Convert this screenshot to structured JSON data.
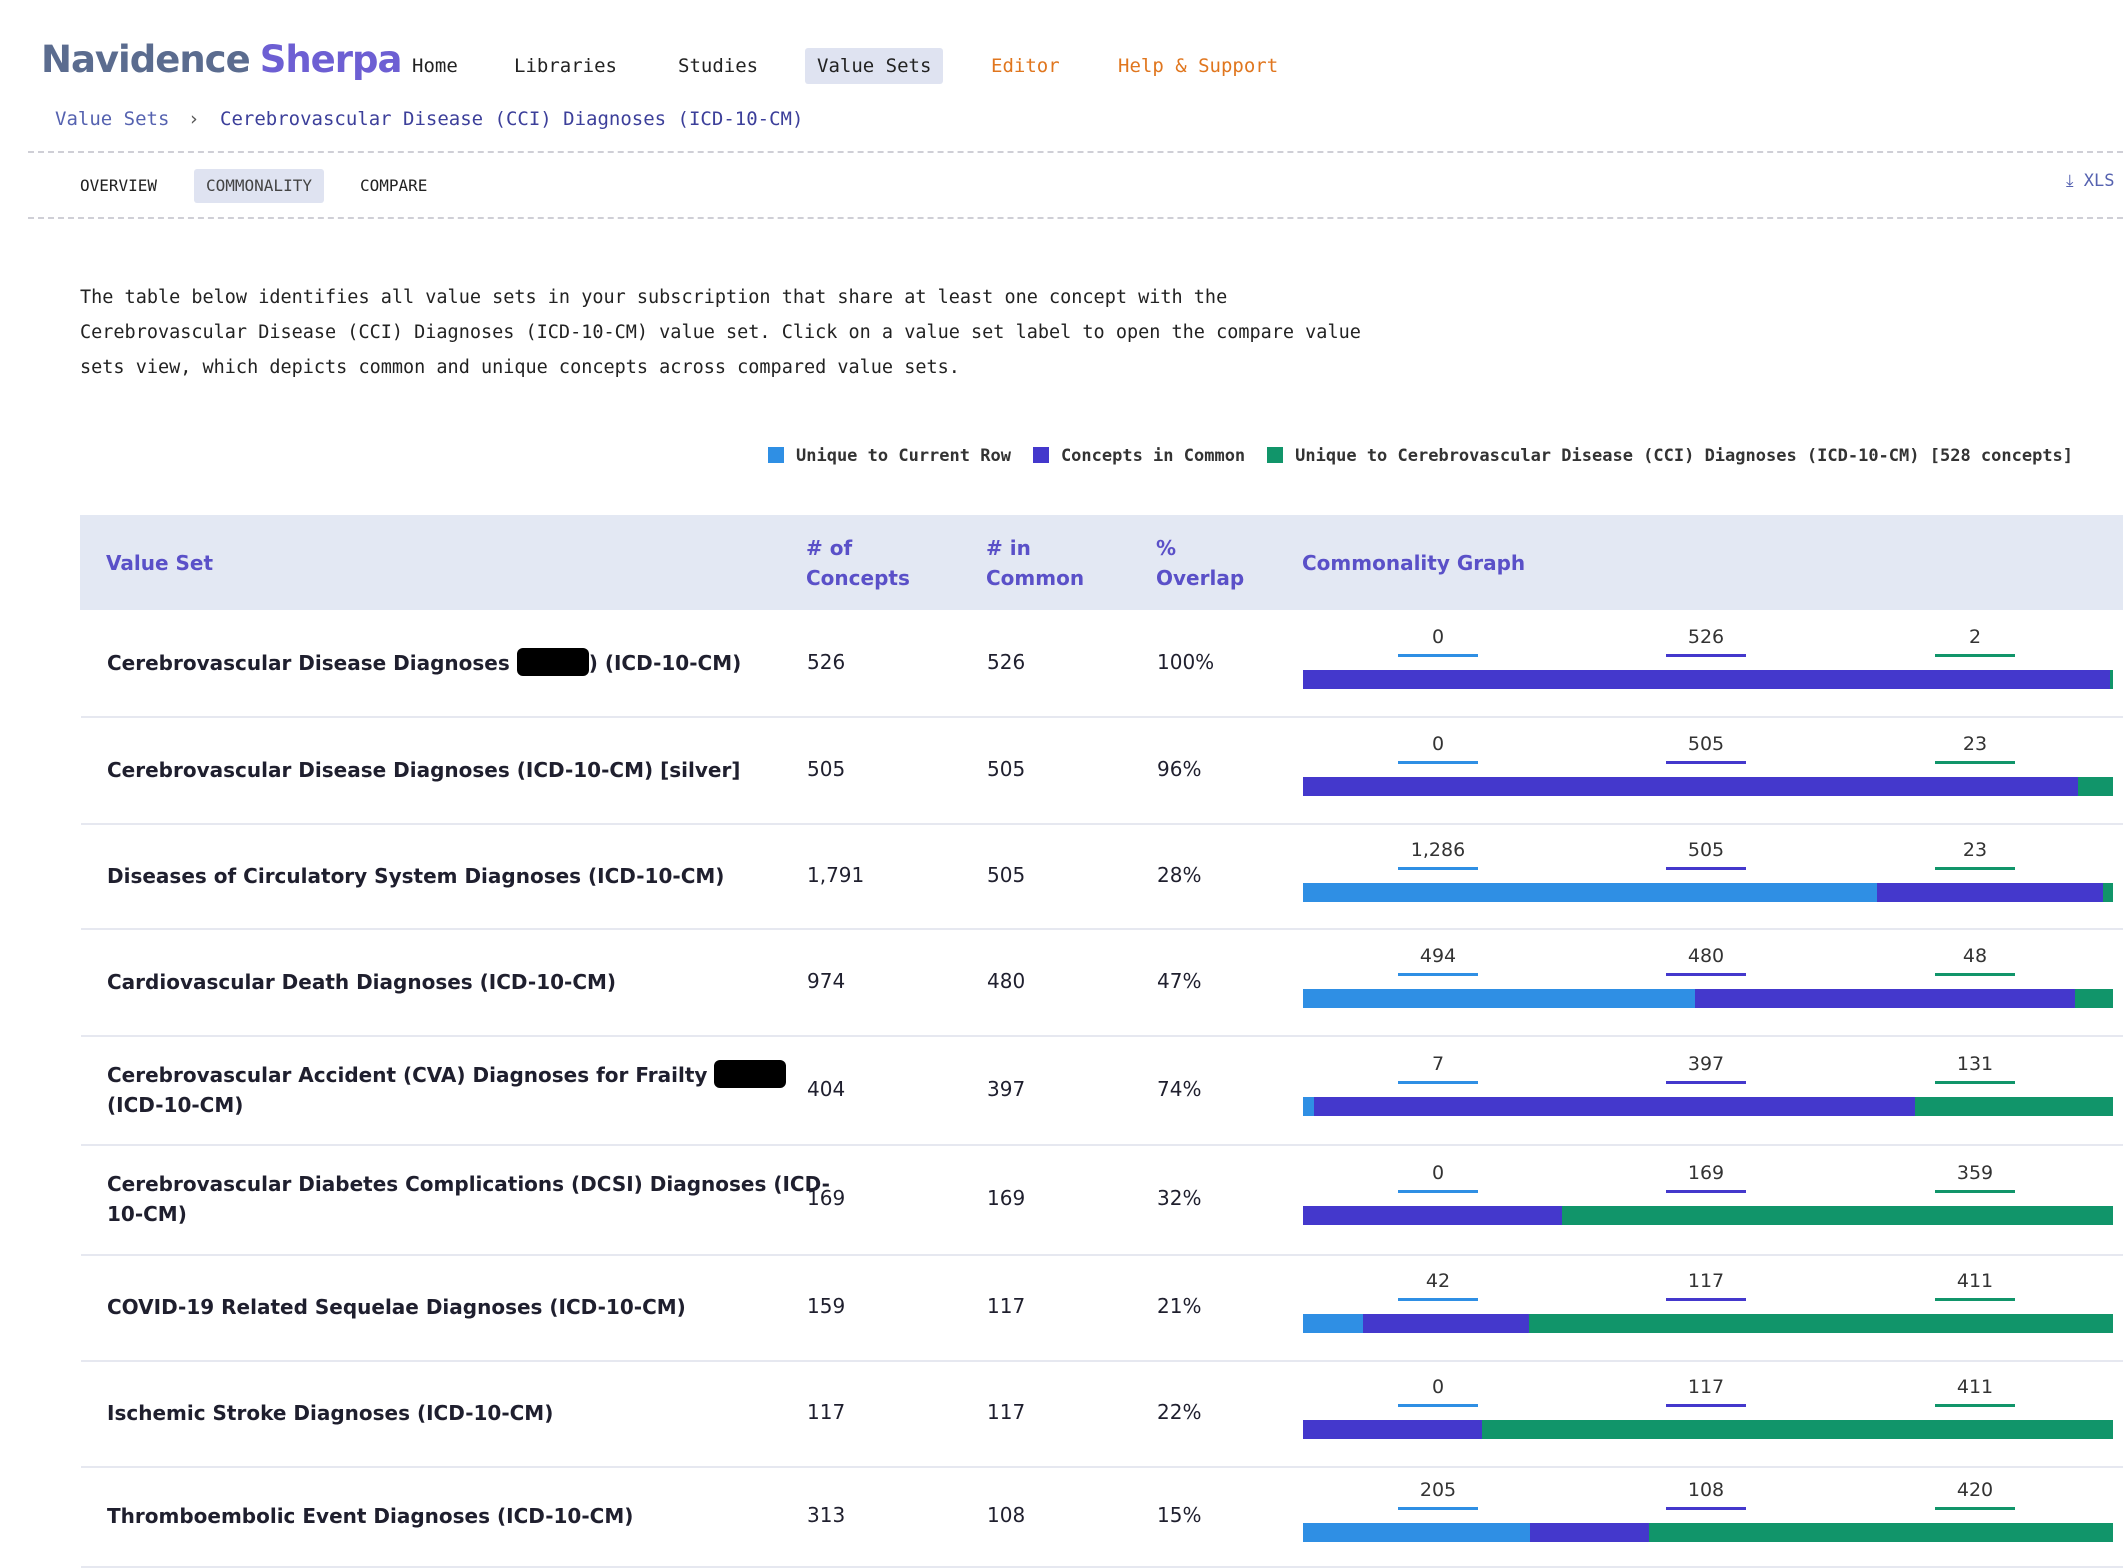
{
  "app": {
    "logo_part1": "Navidence",
    "logo_part2": "Sherpa"
  },
  "nav": [
    {
      "label": "Home"
    },
    {
      "label": "Libraries"
    },
    {
      "label": "Studies"
    },
    {
      "label": "Value Sets"
    },
    {
      "label": "Editor"
    },
    {
      "label": "Help & Support"
    }
  ],
  "breadcrumb": {
    "root": "Value Sets",
    "sep": "›",
    "current": "Cerebrovascular Disease (CCI) Diagnoses (ICD-10-CM)"
  },
  "tabs": [
    {
      "label": "OVERVIEW"
    },
    {
      "label": "COMMONALITY"
    },
    {
      "label": "COMPARE"
    }
  ],
  "export_label": "XLS",
  "description": [
    "The table below identifies all value sets in your subscription that share at least one concept with the",
    "Cerebrovascular Disease (CCI) Diagnoses (ICD-10-CM) value set. Click on a value set label to open the compare value",
    "sets view, which depicts common and unique concepts across compared value sets."
  ],
  "legend": [
    {
      "label": "Unique to Current Row",
      "color": "#2f8fe4"
    },
    {
      "label": "Concepts in Common",
      "color": "#4438cc"
    },
    {
      "label": "Unique to Cerebrovascular Disease (CCI) Diagnoses (ICD-10-CM) [528 concepts]",
      "color": "#11956a"
    }
  ],
  "table": {
    "headers": {
      "value_set": "Value Set",
      "concepts": "# of Concepts",
      "common": "# in Common",
      "overlap": "% Overlap",
      "graph": "Commonality Graph"
    },
    "rows": [
      {
        "name_a": "Cerebrovascular Disease Diagnoses",
        "redacted": true,
        "name_b": ") (ICD-10-CM)",
        "concepts": "526",
        "common": "526",
        "overlap": "100%",
        "unique_row": 0,
        "in_common": 526,
        "unique_ref": 2,
        "unique_row_label": "0",
        "in_common_label": "526",
        "unique_ref_label": "2"
      },
      {
        "name_a": "Cerebrovascular Disease Diagnoses (ICD-10-CM) [silver]",
        "redacted": false,
        "name_b": "",
        "concepts": "505",
        "common": "505",
        "overlap": "96%",
        "unique_row": 0,
        "in_common": 505,
        "unique_ref": 23,
        "unique_row_label": "0",
        "in_common_label": "505",
        "unique_ref_label": "23"
      },
      {
        "name_a": "Diseases of Circulatory System Diagnoses (ICD-10-CM)",
        "redacted": false,
        "name_b": "",
        "concepts": "1,791",
        "common": "505",
        "overlap": "28%",
        "unique_row": 1286,
        "in_common": 505,
        "unique_ref": 23,
        "unique_row_label": "1,286",
        "in_common_label": "505",
        "unique_ref_label": "23"
      },
      {
        "name_a": "Cardiovascular Death Diagnoses (ICD-10-CM)",
        "redacted": false,
        "name_b": "",
        "concepts": "974",
        "common": "480",
        "overlap": "47%",
        "unique_row": 494,
        "in_common": 480,
        "unique_ref": 48,
        "unique_row_label": "494",
        "in_common_label": "480",
        "unique_ref_label": "48"
      },
      {
        "name_a": "Cerebrovascular Accident (CVA) Diagnoses for Frailty",
        "redacted": true,
        "name_b": "(ICD-10-CM)",
        "concepts": "404",
        "common": "397",
        "overlap": "74%",
        "unique_row": 7,
        "in_common": 397,
        "unique_ref": 131,
        "unique_row_label": "7",
        "in_common_label": "397",
        "unique_ref_label": "131"
      },
      {
        "name_a": "Cerebrovascular Diabetes Complications (DCSI) Diagnoses (ICD-10-CM)",
        "redacted": false,
        "name_b": "",
        "concepts": "169",
        "common": "169",
        "overlap": "32%",
        "unique_row": 0,
        "in_common": 169,
        "unique_ref": 359,
        "unique_row_label": "0",
        "in_common_label": "169",
        "unique_ref_label": "359"
      },
      {
        "name_a": "COVID-19 Related Sequelae Diagnoses (ICD-10-CM)",
        "redacted": false,
        "name_b": "",
        "concepts": "159",
        "common": "117",
        "overlap": "21%",
        "unique_row": 42,
        "in_common": 117,
        "unique_ref": 411,
        "unique_row_label": "42",
        "in_common_label": "117",
        "unique_ref_label": "411"
      },
      {
        "name_a": "Ischemic Stroke Diagnoses (ICD-10-CM)",
        "redacted": false,
        "name_b": "",
        "concepts": "117",
        "common": "117",
        "overlap": "22%",
        "unique_row": 0,
        "in_common": 117,
        "unique_ref": 411,
        "unique_row_label": "0",
        "in_common_label": "117",
        "unique_ref_label": "411"
      },
      {
        "name_a": "Thromboembolic Event Diagnoses (ICD-10-CM)",
        "redacted": false,
        "name_b": "",
        "concepts": "313",
        "common": "108",
        "overlap": "15%",
        "unique_row": 205,
        "in_common": 108,
        "unique_ref": 420,
        "unique_row_label": "205",
        "in_common_label": "108",
        "unique_ref_label": "420"
      }
    ]
  },
  "colors": {
    "unique_row": "#2f8fe4",
    "in_common": "#4438cc",
    "unique_ref": "#11956a"
  }
}
